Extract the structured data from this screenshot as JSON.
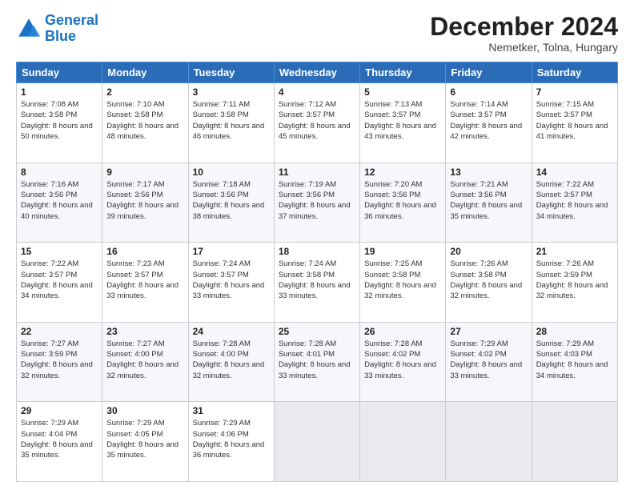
{
  "logo": {
    "line1": "General",
    "line2": "Blue"
  },
  "title": "December 2024",
  "subtitle": "Nemetker, Tolna, Hungary",
  "days_header": [
    "Sunday",
    "Monday",
    "Tuesday",
    "Wednesday",
    "Thursday",
    "Friday",
    "Saturday"
  ],
  "weeks": [
    [
      {
        "day": "1",
        "sunrise": "7:08 AM",
        "sunset": "3:58 PM",
        "daylight": "8 hours and 50 minutes."
      },
      {
        "day": "2",
        "sunrise": "7:10 AM",
        "sunset": "3:58 PM",
        "daylight": "8 hours and 48 minutes."
      },
      {
        "day": "3",
        "sunrise": "7:11 AM",
        "sunset": "3:58 PM",
        "daylight": "8 hours and 46 minutes."
      },
      {
        "day": "4",
        "sunrise": "7:12 AM",
        "sunset": "3:57 PM",
        "daylight": "8 hours and 45 minutes."
      },
      {
        "day": "5",
        "sunrise": "7:13 AM",
        "sunset": "3:57 PM",
        "daylight": "8 hours and 43 minutes."
      },
      {
        "day": "6",
        "sunrise": "7:14 AM",
        "sunset": "3:57 PM",
        "daylight": "8 hours and 42 minutes."
      },
      {
        "day": "7",
        "sunrise": "7:15 AM",
        "sunset": "3:57 PM",
        "daylight": "8 hours and 41 minutes."
      }
    ],
    [
      {
        "day": "8",
        "sunrise": "7:16 AM",
        "sunset": "3:56 PM",
        "daylight": "8 hours and 40 minutes."
      },
      {
        "day": "9",
        "sunrise": "7:17 AM",
        "sunset": "3:56 PM",
        "daylight": "8 hours and 39 minutes."
      },
      {
        "day": "10",
        "sunrise": "7:18 AM",
        "sunset": "3:56 PM",
        "daylight": "8 hours and 38 minutes."
      },
      {
        "day": "11",
        "sunrise": "7:19 AM",
        "sunset": "3:56 PM",
        "daylight": "8 hours and 37 minutes."
      },
      {
        "day": "12",
        "sunrise": "7:20 AM",
        "sunset": "3:56 PM",
        "daylight": "8 hours and 36 minutes."
      },
      {
        "day": "13",
        "sunrise": "7:21 AM",
        "sunset": "3:56 PM",
        "daylight": "8 hours and 35 minutes."
      },
      {
        "day": "14",
        "sunrise": "7:22 AM",
        "sunset": "3:57 PM",
        "daylight": "8 hours and 34 minutes."
      }
    ],
    [
      {
        "day": "15",
        "sunrise": "7:22 AM",
        "sunset": "3:57 PM",
        "daylight": "8 hours and 34 minutes."
      },
      {
        "day": "16",
        "sunrise": "7:23 AM",
        "sunset": "3:57 PM",
        "daylight": "8 hours and 33 minutes."
      },
      {
        "day": "17",
        "sunrise": "7:24 AM",
        "sunset": "3:57 PM",
        "daylight": "8 hours and 33 minutes."
      },
      {
        "day": "18",
        "sunrise": "7:24 AM",
        "sunset": "3:58 PM",
        "daylight": "8 hours and 33 minutes."
      },
      {
        "day": "19",
        "sunrise": "7:25 AM",
        "sunset": "3:58 PM",
        "daylight": "8 hours and 32 minutes."
      },
      {
        "day": "20",
        "sunrise": "7:26 AM",
        "sunset": "3:58 PM",
        "daylight": "8 hours and 32 minutes."
      },
      {
        "day": "21",
        "sunrise": "7:26 AM",
        "sunset": "3:59 PM",
        "daylight": "8 hours and 32 minutes."
      }
    ],
    [
      {
        "day": "22",
        "sunrise": "7:27 AM",
        "sunset": "3:59 PM",
        "daylight": "8 hours and 32 minutes."
      },
      {
        "day": "23",
        "sunrise": "7:27 AM",
        "sunset": "4:00 PM",
        "daylight": "8 hours and 32 minutes."
      },
      {
        "day": "24",
        "sunrise": "7:28 AM",
        "sunset": "4:00 PM",
        "daylight": "8 hours and 32 minutes."
      },
      {
        "day": "25",
        "sunrise": "7:28 AM",
        "sunset": "4:01 PM",
        "daylight": "8 hours and 33 minutes."
      },
      {
        "day": "26",
        "sunrise": "7:28 AM",
        "sunset": "4:02 PM",
        "daylight": "8 hours and 33 minutes."
      },
      {
        "day": "27",
        "sunrise": "7:29 AM",
        "sunset": "4:02 PM",
        "daylight": "8 hours and 33 minutes."
      },
      {
        "day": "28",
        "sunrise": "7:29 AM",
        "sunset": "4:03 PM",
        "daylight": "8 hours and 34 minutes."
      }
    ],
    [
      {
        "day": "29",
        "sunrise": "7:29 AM",
        "sunset": "4:04 PM",
        "daylight": "8 hours and 35 minutes."
      },
      {
        "day": "30",
        "sunrise": "7:29 AM",
        "sunset": "4:05 PM",
        "daylight": "8 hours and 35 minutes."
      },
      {
        "day": "31",
        "sunrise": "7:29 AM",
        "sunset": "4:06 PM",
        "daylight": "8 hours and 36 minutes."
      },
      null,
      null,
      null,
      null
    ]
  ]
}
